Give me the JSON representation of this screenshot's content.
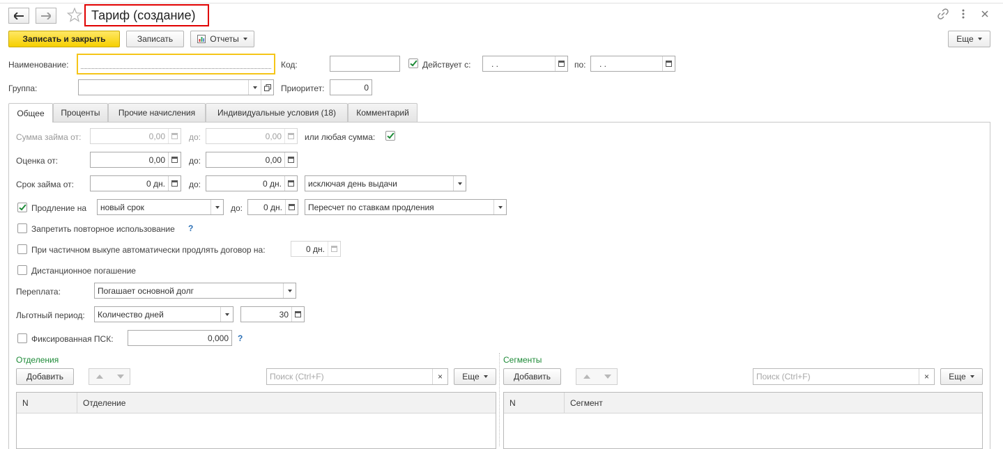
{
  "window": {
    "title": "Тариф (создание)",
    "icons": [
      "back-arrow-icon",
      "forward-arrow-icon",
      "favorite-star-icon",
      "link-icon",
      "more-vertical-icon",
      "close-icon"
    ]
  },
  "toolbar": {
    "save_close_label": "Записать и закрыть",
    "save_label": "Записать",
    "reports_label": "Отчеты",
    "more_label": "Еще"
  },
  "header": {
    "name_label": "Наименование:",
    "name_value": "",
    "code_label": "Код:",
    "code_value": "",
    "active_from_label": "Действует с:",
    "active_from_checked": true,
    "active_from_value": " .  .",
    "to_label": "по:",
    "to_value": " .  .",
    "group_label": "Группа:",
    "group_value": "",
    "priority_label": "Приоритет:",
    "priority_value": "0"
  },
  "tabs": [
    {
      "label": "Общее",
      "active": true
    },
    {
      "label": "Проценты",
      "active": false
    },
    {
      "label": "Прочие начисления",
      "active": false
    },
    {
      "label": "Индивидуальные условия (18)",
      "active": false
    },
    {
      "label": "Комментарий",
      "active": false
    }
  ],
  "general": {
    "loan_sum_from_label": "Сумма займа от:",
    "loan_sum_from": "0,00",
    "loan_sum_to_label": "до:",
    "loan_sum_to": "0,00",
    "any_sum_label": "или любая сумма:",
    "any_sum_checked": true,
    "score_from_label": "Оценка от:",
    "score_from": "0,00",
    "score_to_label": "до:",
    "score_to": "0,00",
    "term_from_label": "Срок займа от:",
    "term_from": "0 дн.",
    "term_to_label": "до:",
    "term_to": "0 дн.",
    "term_mode": "исключая день выдачи",
    "extension_label": "Продление на",
    "extension_checked": true,
    "extension_mode": "новый срок",
    "extension_to_label": "до:",
    "extension_to": "0 дн.",
    "extension_recalc": "Пересчет по ставкам продления",
    "forbid_reuse_label": "Запретить повторное использование",
    "forbid_reuse_checked": false,
    "partial_buyout_label": "При частичном выкупе автоматически продлять договор на:",
    "partial_buyout_checked": false,
    "partial_buyout_days": "0 дн.",
    "remote_repayment_label": "Дистанционное погашение",
    "remote_repayment_checked": false,
    "overpayment_label": "Переплата:",
    "overpayment_value": "Погашает основной долг",
    "grace_label": "Льготный период:",
    "grace_mode": "Количество дней",
    "grace_days": "30",
    "fixed_psk_label": "Фиксированная ПСК:",
    "fixed_psk_checked": false,
    "fixed_psk_value": "0,000",
    "help_mark": "?"
  },
  "departments": {
    "title": "Отделения",
    "add_label": "Добавить",
    "search_placeholder": "Поиск (Ctrl+F)",
    "clear_label": "×",
    "more_label": "Еще",
    "columns": [
      "N",
      "Отделение"
    ]
  },
  "segments": {
    "title": "Сегменты",
    "add_label": "Добавить",
    "search_placeholder": "Поиск (Ctrl+F)",
    "clear_label": "×",
    "more_label": "Еще",
    "columns": [
      "N",
      "Сегмент"
    ]
  },
  "colors": {
    "accent_yellow": "#f6cf00",
    "check_green": "#1d8a37",
    "title_outline_red": "#e00000",
    "help_blue": "#2a6fb5"
  }
}
